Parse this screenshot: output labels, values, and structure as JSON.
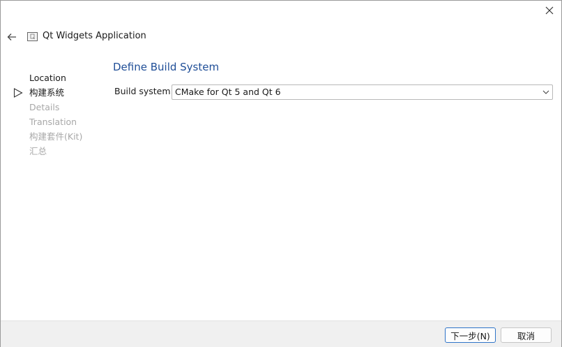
{
  "window": {
    "title": "Qt Widgets Application",
    "close_icon": "close-icon",
    "back_icon": "arrow-left-icon",
    "app_icon": "qt-project-icon"
  },
  "steps": [
    {
      "label": "Location",
      "state": "done"
    },
    {
      "label": "构建系统",
      "state": "current"
    },
    {
      "label": "Details",
      "state": "pending"
    },
    {
      "label": "Translation",
      "state": "pending"
    },
    {
      "label": "构建套件(Kit)",
      "state": "pending"
    },
    {
      "label": "汇总",
      "state": "pending"
    }
  ],
  "page": {
    "title": "Define Build System",
    "build_system_label": "Build system:",
    "build_system_value": "CMake for Qt 5 and Qt 6"
  },
  "footer": {
    "next_label": "下一步(N)",
    "cancel_label": "取消"
  },
  "colors": {
    "title_blue": "#1f4e97",
    "pending_text": "#a8a8a8",
    "primary_border": "#2f74c8",
    "footer_bg": "#f0f0f0"
  }
}
